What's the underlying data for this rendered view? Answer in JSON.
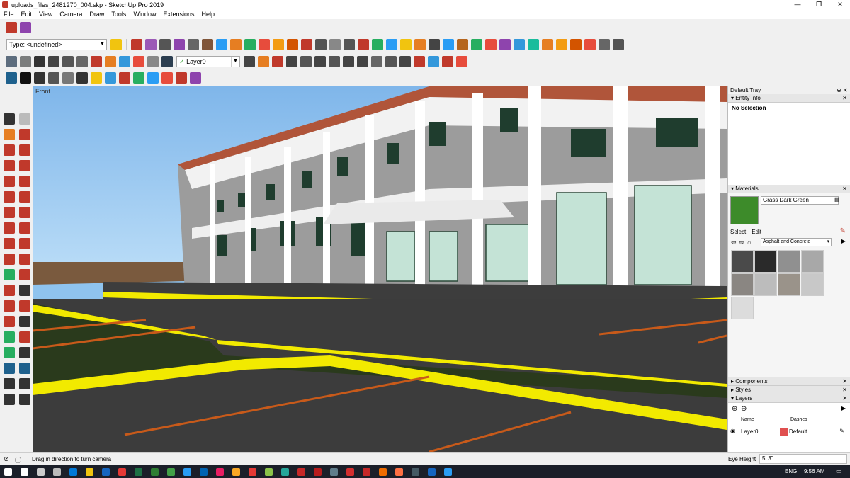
{
  "window": {
    "title": "uploads_files_2481270_004.skp - SketchUp Pro 2019",
    "minimize": "—",
    "restore": "❐",
    "close": "✕"
  },
  "menu": [
    "File",
    "Edit",
    "View",
    "Camera",
    "Draw",
    "Tools",
    "Window",
    "Extensions",
    "Help"
  ],
  "toolbar": {
    "type_combo": "Type: <undefined>",
    "layer_combo": "Layer0",
    "tb1_icon_colors": [
      "#c0392b",
      "#9b59b6",
      "#555",
      "#8e44ad",
      "#666",
      "#7f5539",
      "#2a9df4",
      "#e67e22",
      "#27ae60",
      "#e74c3c",
      "#f39c12",
      "#d35400",
      "#c0392b",
      "#555",
      "#888",
      "#555",
      "#c0392b",
      "#27ae60",
      "#2a9df4",
      "#f1c40f",
      "#e67e22",
      "#444",
      "#2a9df4",
      "#b5651d",
      "#27ae60",
      "#e74c3c",
      "#8e44ad",
      "#3498db",
      "#1abc9c",
      "#e67e22",
      "#f39c12",
      "#d35400",
      "#e74c3c",
      "#666",
      "#555"
    ],
    "tb2_icon_colors": [
      "#5d6d7e",
      "#7b7d7d",
      "#333",
      "#444",
      "#555",
      "#666",
      "#c0392b",
      "#e67e22",
      "#3498db",
      "#e74c3c",
      "#888",
      "#2c3e50",
      "#444",
      "#e67e22",
      "#c0392b",
      "#444",
      "#555",
      "#444",
      "#555",
      "#444",
      "#444",
      "#666",
      "#555",
      "#444",
      "#c0392b",
      "#3498db",
      "#c0392b",
      "#e74c3c"
    ],
    "tb3_icon_colors": [
      "#1f618d",
      "#111",
      "#333",
      "#555",
      "#777",
      "#333",
      "#f1c40f",
      "#3498db",
      "#c0392b",
      "#27ae60",
      "#2a9df4",
      "#e74c3c",
      "#c0392b",
      "#8e44ad"
    ]
  },
  "left_tool_colors": [
    "#333",
    "#bbb",
    "#e67e22",
    "#c0392b",
    "#c0392b",
    "#c0392b",
    "#c0392b",
    "#c0392b",
    "#c0392b",
    "#c0392b",
    "#c0392b",
    "#c0392b",
    "#c0392b",
    "#c0392b",
    "#c0392b",
    "#c0392b",
    "#c0392b",
    "#c0392b",
    "#c0392b",
    "#c0392b",
    "#27ae60",
    "#c0392b",
    "#c0392b",
    "#333",
    "#c0392b",
    "#c0392b",
    "#c0392b",
    "#333",
    "#27ae60",
    "#c0392b",
    "#27ae60",
    "#333",
    "#1f618d",
    "#1f618d",
    "#333",
    "#333",
    "#333",
    "#333"
  ],
  "viewport": {
    "label": "Front"
  },
  "tray": {
    "title": "Default Tray",
    "entity_info": {
      "label": "Entity Info",
      "value": "No Selection"
    },
    "materials": {
      "label": "Materials",
      "name": "Grass Dark Green",
      "swatch_color": "#3d8b2a",
      "tabs": [
        "Select",
        "Edit"
      ],
      "library": "Asphalt and Concrete",
      "swatches": [
        "#4a4a4a",
        "#2a2a2a",
        "#909090",
        "#a8a8a8",
        "#8a8682",
        "#bcbcbc",
        "#9a938a",
        "#c8c8c8",
        "#dcdcdc"
      ]
    },
    "components": {
      "label": "Components"
    },
    "styles": {
      "label": "Styles"
    },
    "layers": {
      "label": "Layers",
      "columns": [
        "Name",
        "Dashes"
      ],
      "rows": [
        {
          "name": "Layer0",
          "color": "#e05050",
          "dashes": "Default"
        }
      ]
    }
  },
  "status": {
    "message": "Drag in direction to turn camera",
    "measure_label": "Eye Height",
    "measure_value": "5' 3\""
  },
  "taskbar": {
    "icon_colors": [
      "#fff",
      "#fff",
      "#ccc",
      "#bbb",
      "#0078d7",
      "#f1c40f",
      "#1565c0",
      "#e53935",
      "#1e7145",
      "#2e7d32",
      "#43a047",
      "#2a9df4",
      "#0063b1",
      "#e91e63",
      "#f9a825",
      "#e53935",
      "#8bc34a",
      "#26a69a",
      "#c62828",
      "#b71c1c",
      "#607d8b",
      "#d32f2f",
      "#c62828",
      "#ef6c00",
      "#ff7043",
      "#455a64",
      "#1565c0",
      "#2a9df4"
    ],
    "lang": "ENG",
    "time": "9:56 AM"
  }
}
